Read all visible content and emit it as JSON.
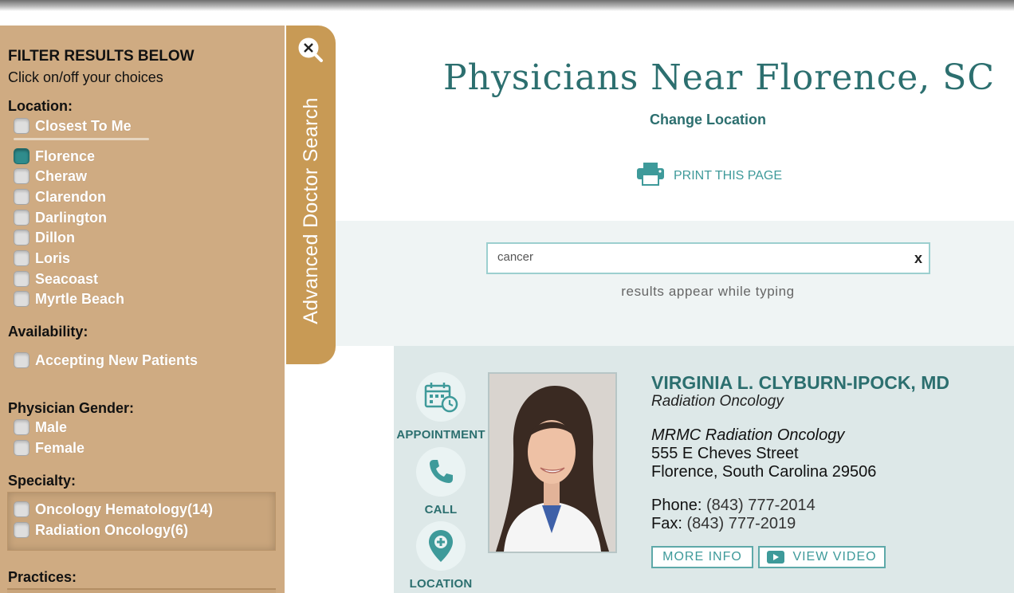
{
  "filters": {
    "title": "FILTER RESULTS BELOW",
    "subtitle": "Click on/off your choices",
    "location": {
      "heading": "Location:",
      "options": [
        {
          "label": "Closest To Me",
          "checked": false
        },
        {
          "label": "Florence",
          "checked": true
        },
        {
          "label": "Cheraw",
          "checked": false
        },
        {
          "label": "Clarendon",
          "checked": false
        },
        {
          "label": "Darlington",
          "checked": false
        },
        {
          "label": "Dillon",
          "checked": false
        },
        {
          "label": "Loris",
          "checked": false
        },
        {
          "label": "Seacoast",
          "checked": false
        },
        {
          "label": "Myrtle Beach",
          "checked": false
        }
      ]
    },
    "availability": {
      "heading": "Availability:",
      "options": [
        {
          "label": "Accepting New Patients",
          "checked": false
        }
      ]
    },
    "gender": {
      "heading": "Physician Gender:",
      "options": [
        {
          "label": "Male",
          "checked": false
        },
        {
          "label": "Female",
          "checked": false
        }
      ]
    },
    "specialty": {
      "heading": "Specialty:",
      "options": [
        {
          "label": "Oncology Hematology(14)",
          "checked": false
        },
        {
          "label": "Radiation Oncology(6)",
          "checked": false
        }
      ]
    },
    "practices": {
      "heading": "Practices:"
    }
  },
  "advanced_tab": {
    "label": "Advanced Doctor Search"
  },
  "header": {
    "title": "Physicians Near Florence, SC",
    "change_location": "Change Location",
    "print_label": "PRINT THIS PAGE"
  },
  "search": {
    "value": "cancer",
    "clear_label": "x",
    "hint": "results appear while typing"
  },
  "result": {
    "actions": {
      "appointment": "APPOINTMENT",
      "call": "CALL",
      "location": "LOCATION"
    },
    "name": "VIRGINIA L. CLYBURN-IPOCK, MD",
    "specialty": "Radiation Oncology",
    "practice": "MRMC Radiation Oncology",
    "address_line1": "555 E Cheves Street",
    "address_line2": "Florence, South Carolina 29506",
    "phone_label": "Phone:",
    "phone": "(843) 777-2014",
    "fax_label": "Fax:",
    "fax": "(843) 777-2019",
    "more_info_label": "MORE INFO",
    "video_label": "VIEW VIDEO"
  },
  "colors": {
    "teal": "#2c6f6f",
    "teal_light": "#3e9a9a",
    "panel_tan": "#cfab82",
    "tab_gold": "#c89a55",
    "card_bg": "#dde8e8"
  }
}
